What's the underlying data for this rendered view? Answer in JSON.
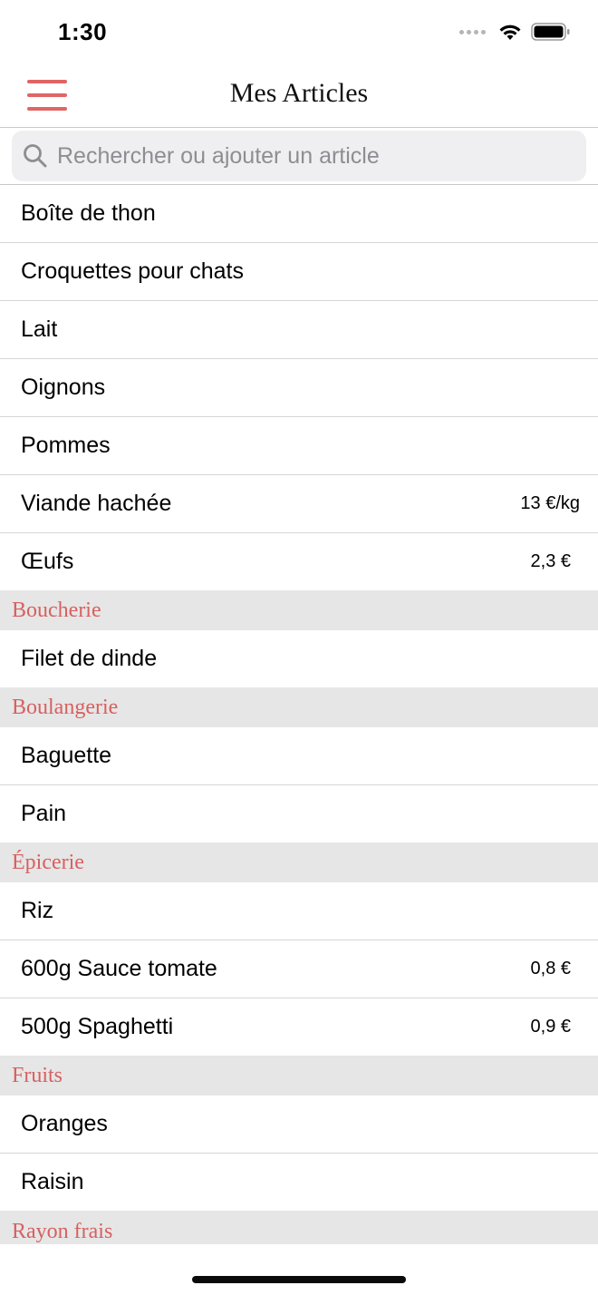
{
  "status": {
    "time": "1:30"
  },
  "nav": {
    "title": "Mes Articles"
  },
  "search": {
    "placeholder": "Rechercher ou ajouter un article"
  },
  "items": [
    {
      "name": "Boîte de thon",
      "price": ""
    },
    {
      "name": "Croquettes pour chats",
      "price": ""
    },
    {
      "name": "Lait",
      "price": ""
    },
    {
      "name": "Oignons",
      "price": ""
    },
    {
      "name": "Pommes",
      "price": ""
    },
    {
      "name": "Viande hachée",
      "price": "13 €/kg"
    },
    {
      "name": "Œufs",
      "price": "2,3 €"
    }
  ],
  "sections": [
    {
      "title": "Boucherie",
      "items": [
        {
          "name": "Filet de dinde",
          "price": ""
        }
      ]
    },
    {
      "title": "Boulangerie",
      "items": [
        {
          "name": "Baguette",
          "price": ""
        },
        {
          "name": "Pain",
          "price": ""
        }
      ]
    },
    {
      "title": "Épicerie",
      "items": [
        {
          "name": "Riz",
          "price": ""
        },
        {
          "name": "600g Sauce tomate",
          "price": "0,8 €"
        },
        {
          "name": "500g Spaghetti",
          "price": "0,9 €"
        }
      ]
    },
    {
      "title": "Fruits",
      "items": [
        {
          "name": "Oranges",
          "price": ""
        },
        {
          "name": "Raisin",
          "price": ""
        }
      ]
    },
    {
      "title": "Rayon frais",
      "items": []
    }
  ],
  "colors": {
    "accent": "#e06565",
    "section_text": "#d76060",
    "section_bg": "#e6e6e6"
  }
}
